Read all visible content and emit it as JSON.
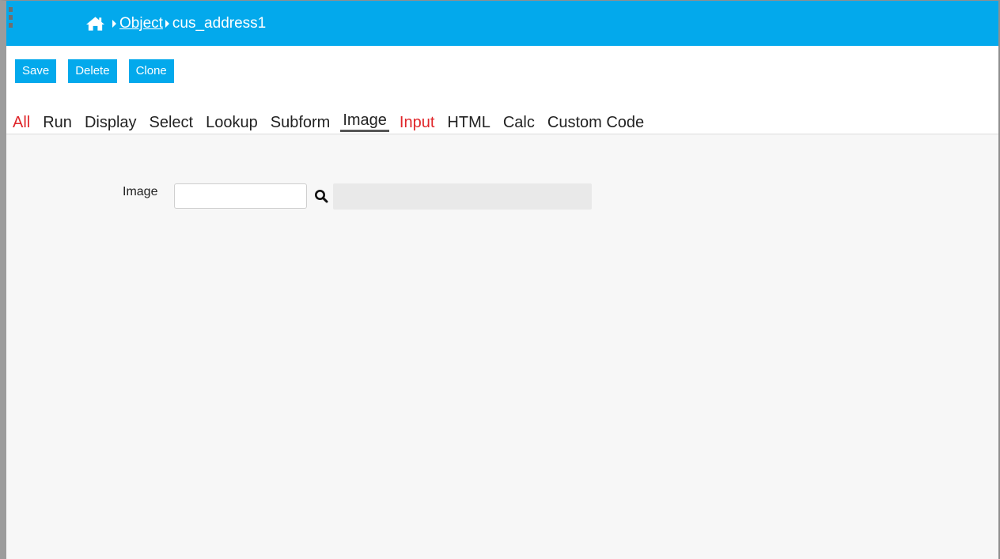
{
  "header": {
    "home_icon": "home-icon",
    "breadcrumb": {
      "link": "Object",
      "current": "cus_address1"
    },
    "color": "#03a9ec"
  },
  "toolbar": {
    "save_label": "Save",
    "delete_label": "Delete",
    "clone_label": "Clone"
  },
  "tabs": [
    {
      "label": "All",
      "color": "#e0262a"
    },
    {
      "label": "Run"
    },
    {
      "label": "Display"
    },
    {
      "label": "Select"
    },
    {
      "label": "Lookup"
    },
    {
      "label": "Subform"
    },
    {
      "label": "Image",
      "active": true
    },
    {
      "label": "Input",
      "color": "#e0262a"
    },
    {
      "label": "HTML"
    },
    {
      "label": "Calc"
    },
    {
      "label": "Custom Code"
    }
  ],
  "form": {
    "image_label": "Image",
    "image_value": "",
    "image_display": "",
    "search_icon": "search-icon"
  }
}
